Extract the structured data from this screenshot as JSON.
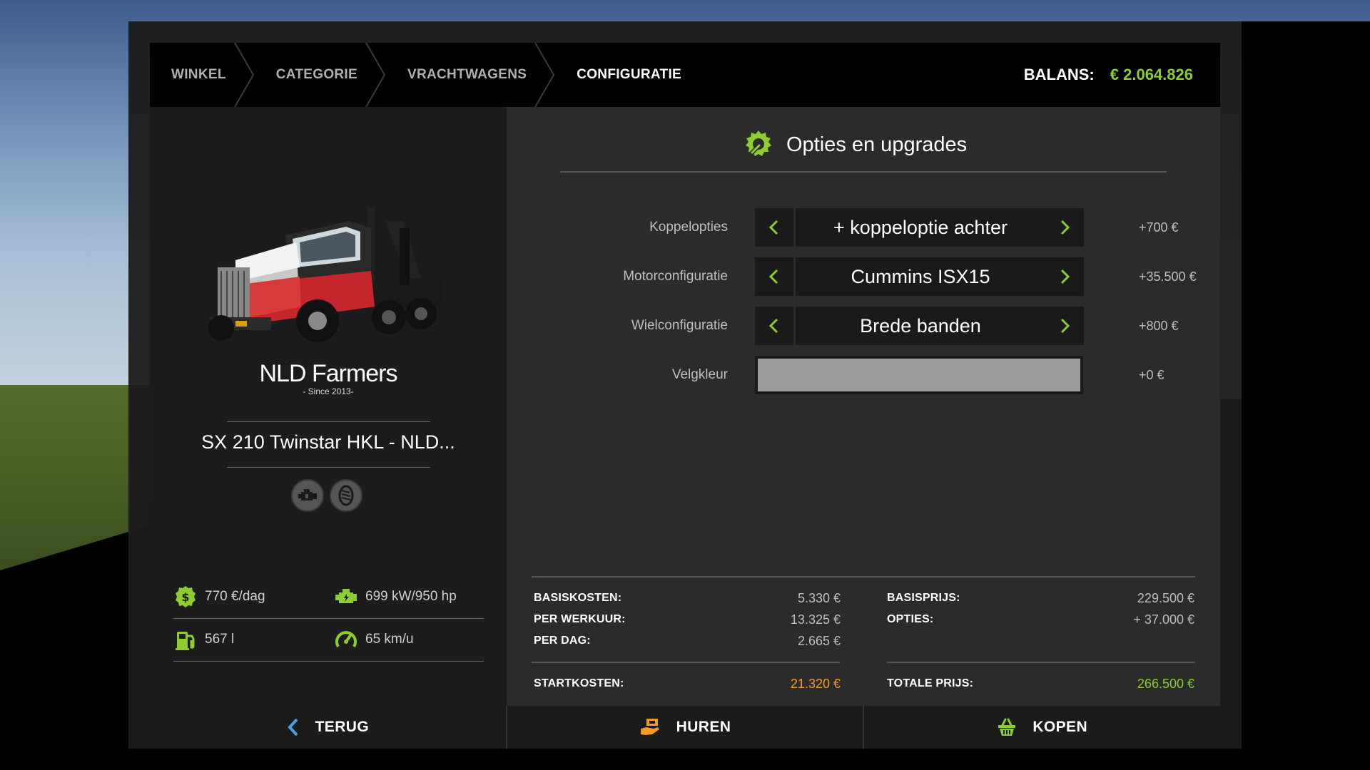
{
  "breadcrumb": [
    {
      "label": "WINKEL",
      "active": false
    },
    {
      "label": "CATEGORIE",
      "active": false
    },
    {
      "label": "VRACHTWAGENS",
      "active": false
    },
    {
      "label": "CONFIGURATIE",
      "active": true
    }
  ],
  "balance": {
    "label": "BALANS:",
    "value": "€ 2.064.826"
  },
  "vehicle": {
    "brand": "NLD Farmers",
    "brand_tagline": "- Since 2013-",
    "name": "SX 210 Twinstar HKL - NLD...",
    "badges": [
      "engine-icon",
      "tire-icon"
    ],
    "stats": {
      "daily_cost": "770 €/dag",
      "power": "699 kW/950 hp",
      "fuel": "567 l",
      "speed": "65 km/u"
    }
  },
  "options": {
    "title": "Opties en upgrades",
    "rows": [
      {
        "label": "Koppelopties",
        "value": "+ koppeloptie achter",
        "price": "+700 €"
      },
      {
        "label": "Motorconfiguratie",
        "value": "Cummins ISX15",
        "price": "+35.500 €"
      },
      {
        "label": "Wielconfiguratie",
        "value": "Brede banden",
        "price": "+800 €"
      },
      {
        "label": "Velgkleur",
        "value": "",
        "price": "+0 €",
        "color": "#9b9b9b"
      }
    ]
  },
  "costs": {
    "basiskosten": {
      "label": "BASISKOSTEN:",
      "value": "5.330 €"
    },
    "per_werkuur": {
      "label": "PER WERKUUR:",
      "value": "13.325 €"
    },
    "per_dag": {
      "label": "PER DAG:",
      "value": "2.665 €"
    },
    "startkosten": {
      "label": "STARTKOSTEN:",
      "value": "21.320 €"
    },
    "basisprijs": {
      "label": "BASISPRIJS:",
      "value": "229.500 €"
    },
    "opties": {
      "label": "OPTIES:",
      "value": "+ 37.000 €"
    },
    "totale_prijs": {
      "label": "TOTALE PRIJS:",
      "value": "266.500 €"
    }
  },
  "buttons": {
    "back": "TERUG",
    "rent": "HUREN",
    "buy": "KOPEN"
  },
  "colors": {
    "accent": "#8ccd2f",
    "orange": "#f59a23",
    "blue": "#3fa6e6"
  }
}
